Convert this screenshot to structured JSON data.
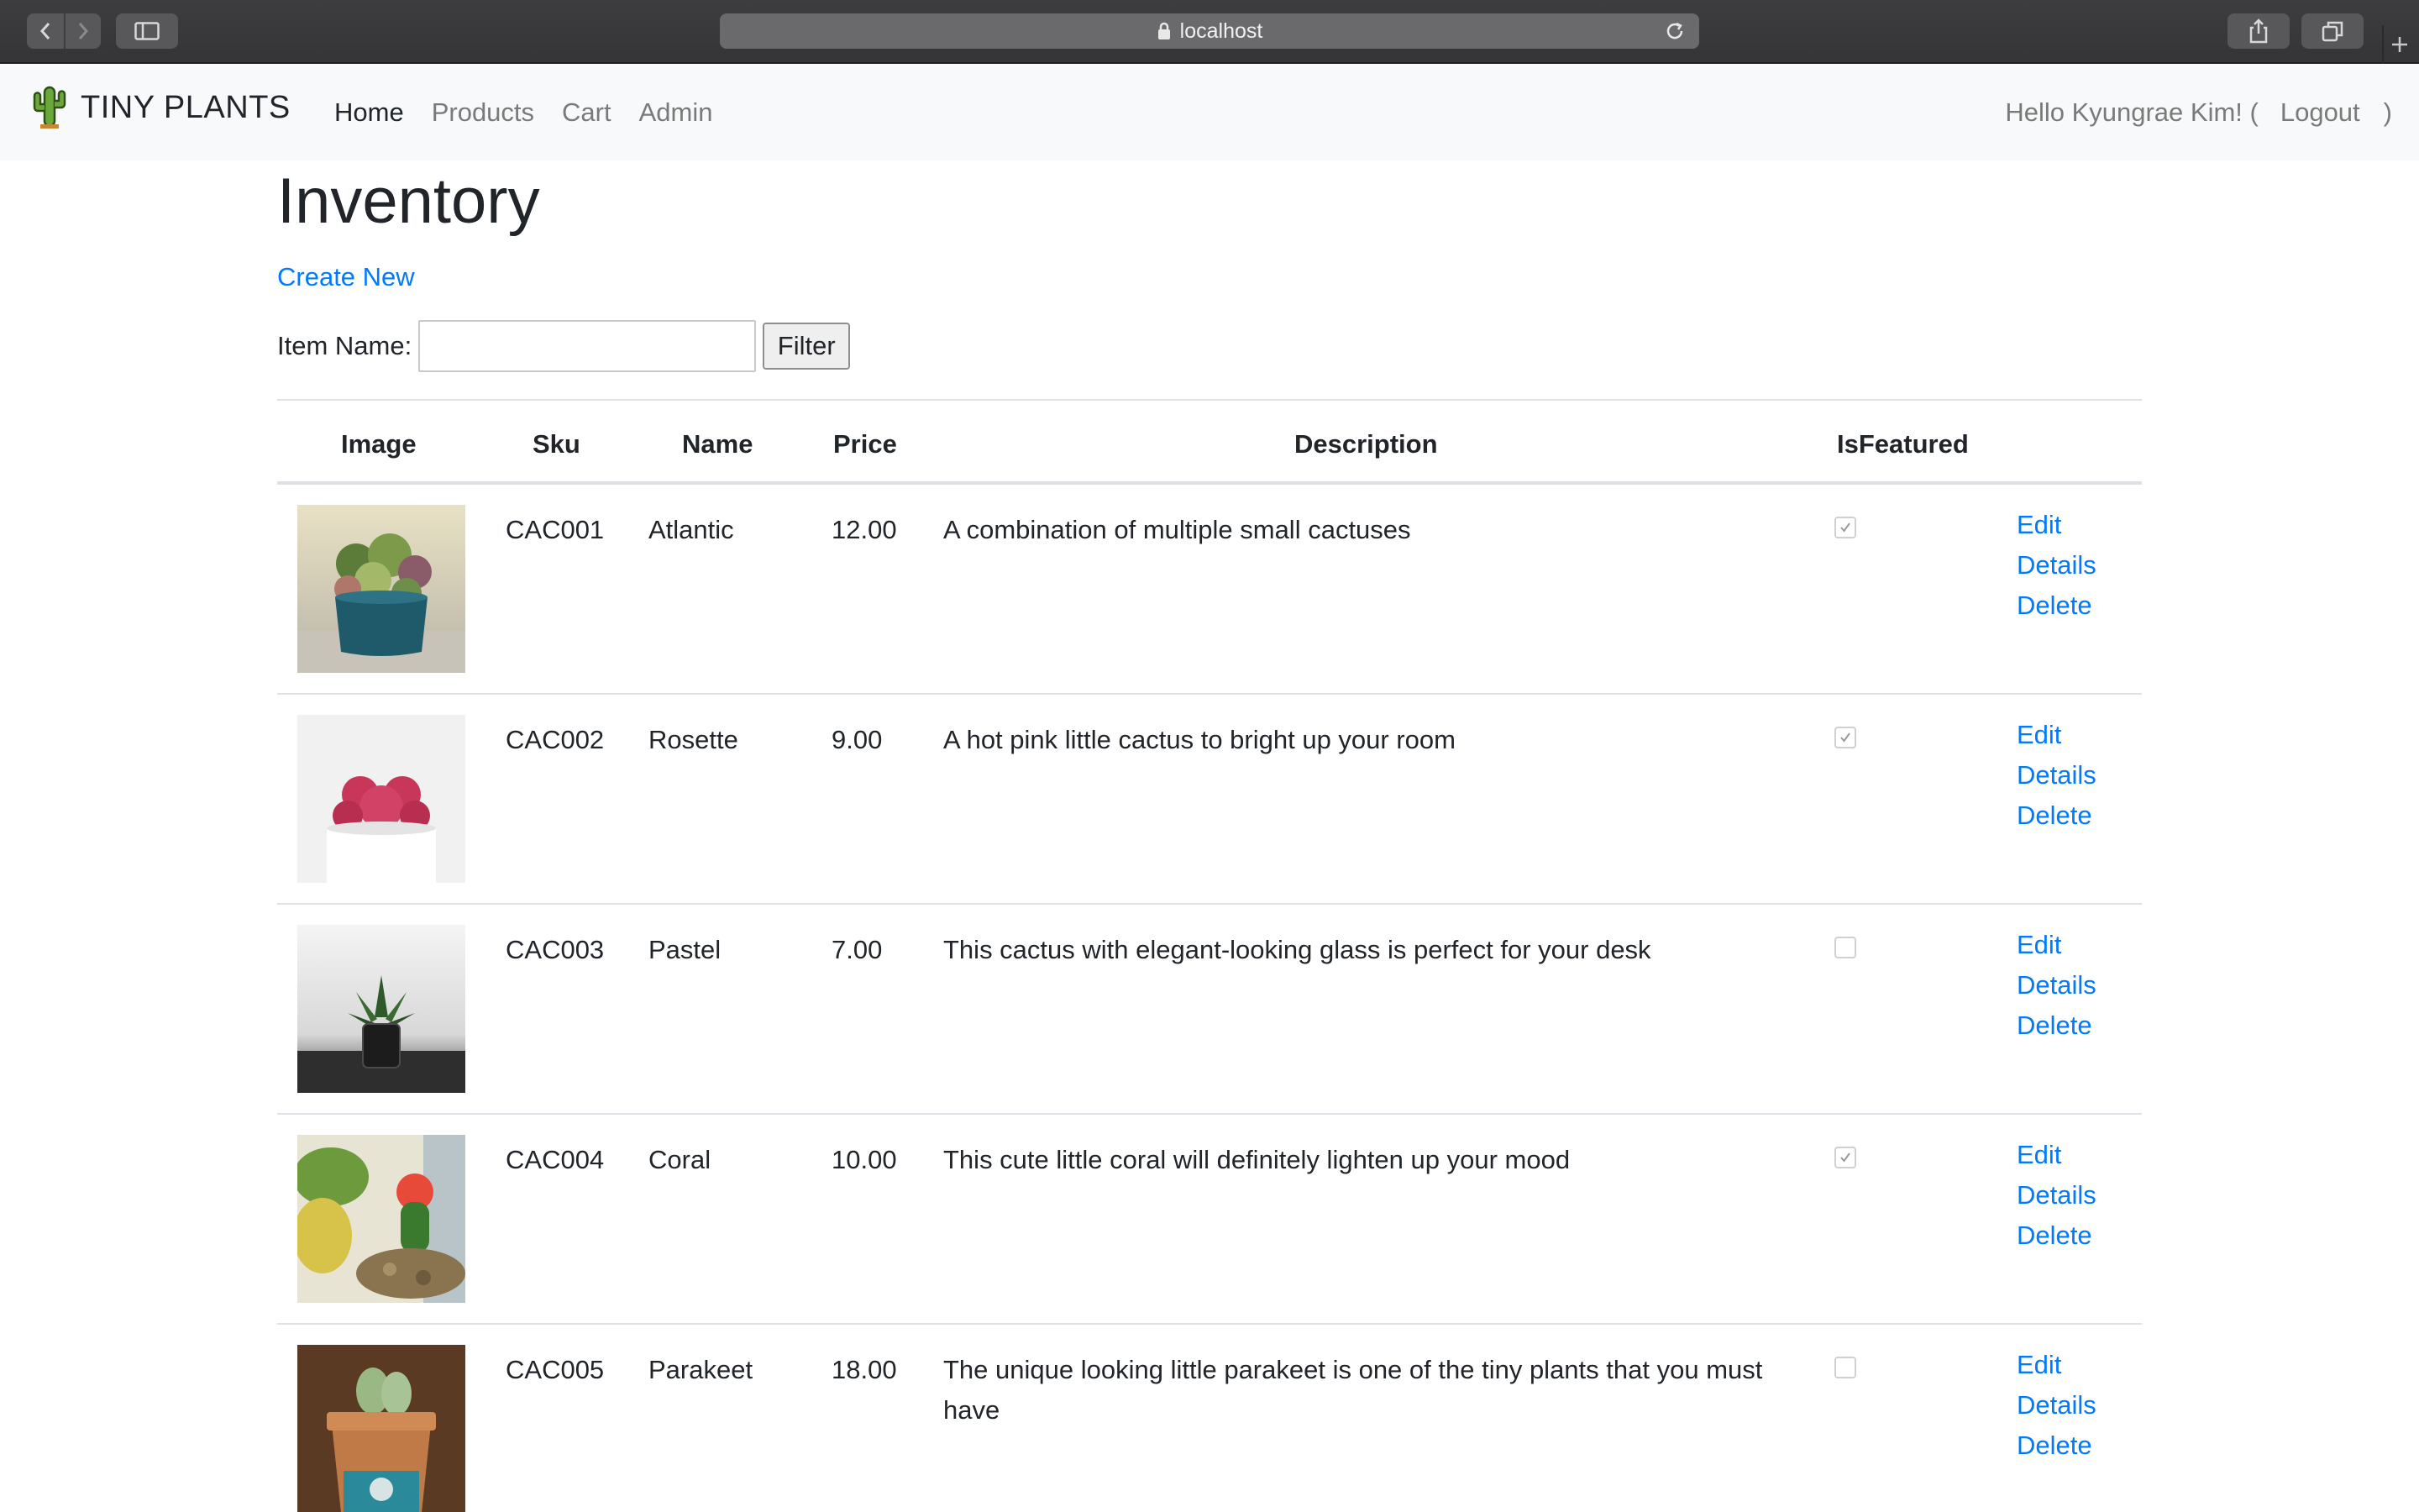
{
  "browser": {
    "address": "localhost"
  },
  "navbar": {
    "brand": "TINY PLANTS",
    "links": [
      "Home",
      "Products",
      "Cart",
      "Admin"
    ],
    "greeting": "Hello Kyungrae Kim! (",
    "logout": "Logout",
    "greeting_close": ")"
  },
  "page": {
    "title": "Inventory",
    "create_new": "Create New",
    "filter_label": "Item Name:",
    "filter_value": "",
    "filter_button": "Filter"
  },
  "table": {
    "headers": [
      "Image",
      "Sku",
      "Name",
      "Price",
      "Description",
      "IsFeatured"
    ],
    "actions": [
      "Edit",
      "Details",
      "Delete"
    ],
    "rows": [
      {
        "sku": "CAC001",
        "name": "Atlantic",
        "price": "12.00",
        "description": "A combination of multiple small cactuses",
        "featured": true
      },
      {
        "sku": "CAC002",
        "name": "Rosette",
        "price": "9.00",
        "description": "A hot pink little cactus to bright up your room",
        "featured": true
      },
      {
        "sku": "CAC003",
        "name": "Pastel",
        "price": "7.00",
        "description": "This cactus with elegant-looking glass is perfect for your desk",
        "featured": false
      },
      {
        "sku": "CAC004",
        "name": "Coral",
        "price": "10.00",
        "description": "This cute little coral will definitely lighten up your mood",
        "featured": true
      },
      {
        "sku": "CAC005",
        "name": "Parakeet",
        "price": "18.00",
        "description": "The unique looking little parakeet is one of the tiny plants that you must have",
        "featured": false
      }
    ]
  },
  "colors": {
    "link": "#007bff",
    "navbar_bg": "#f8f9fa",
    "muted": "#7a7a7a"
  }
}
